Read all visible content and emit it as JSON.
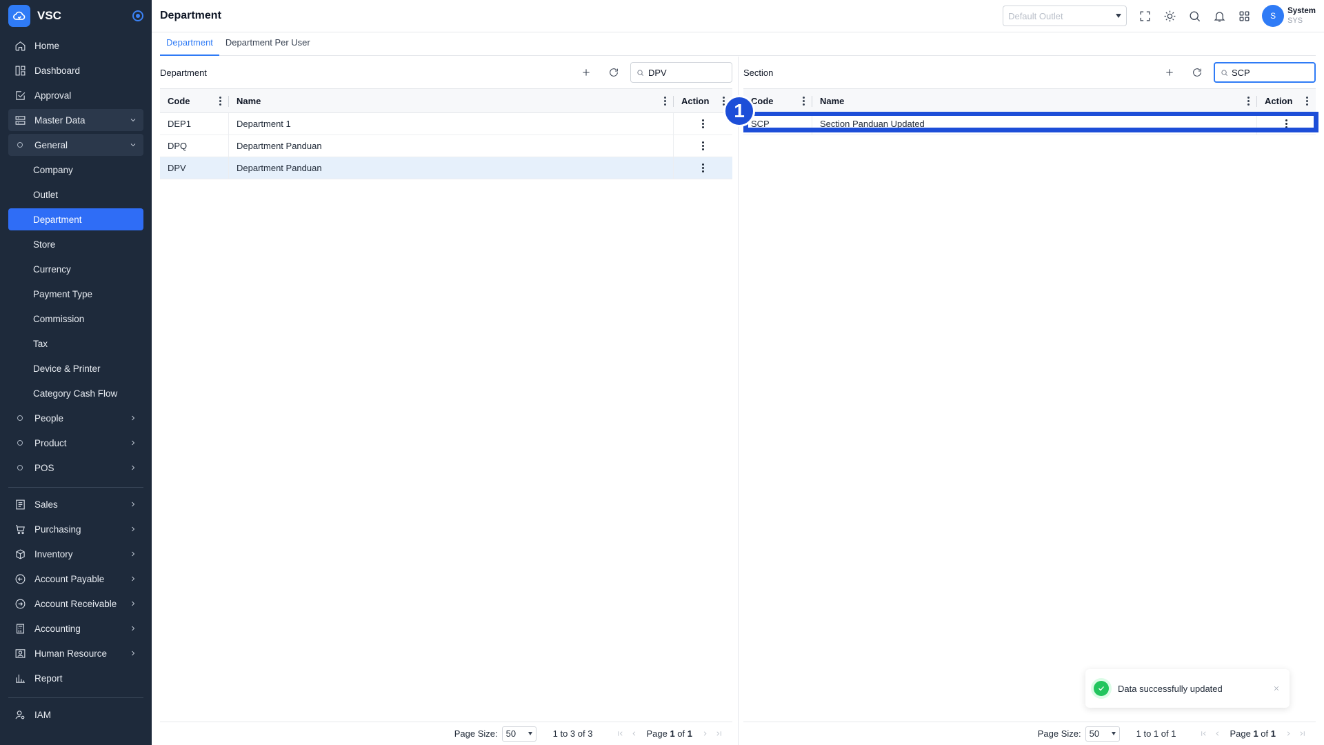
{
  "app": {
    "name": "VSC"
  },
  "header": {
    "title": "Department",
    "outlet_placeholder": "Default Outlet",
    "user": {
      "initial": "S",
      "name": "System",
      "code": "SYS"
    }
  },
  "sidebar": {
    "top": [
      {
        "label": "Home",
        "icon": "home-icon"
      },
      {
        "label": "Dashboard",
        "icon": "dashboard-icon"
      },
      {
        "label": "Approval",
        "icon": "approval-icon"
      },
      {
        "label": "Master Data",
        "icon": "master-data-icon"
      }
    ],
    "general_label": "General",
    "general_items": [
      "Company",
      "Outlet",
      "Department",
      "Store",
      "Currency",
      "Payment Type",
      "Commission",
      "Tax",
      "Device & Printer",
      "Category Cash Flow"
    ],
    "master_groups": [
      "People",
      "Product",
      "POS"
    ],
    "modules": [
      {
        "label": "Sales",
        "icon": "sales-icon"
      },
      {
        "label": "Purchasing",
        "icon": "cart-icon"
      },
      {
        "label": "Inventory",
        "icon": "box-icon"
      },
      {
        "label": "Account Payable",
        "icon": "arrow-left-circle-icon"
      },
      {
        "label": "Account Receivable",
        "icon": "arrow-right-circle-icon"
      },
      {
        "label": "Accounting",
        "icon": "calculator-icon"
      },
      {
        "label": "Human Resource",
        "icon": "person-card-icon"
      },
      {
        "label": "Report",
        "icon": "report-icon"
      }
    ],
    "iam_label": "IAM"
  },
  "tabs": [
    "Department",
    "Department Per User"
  ],
  "department_panel": {
    "title": "Department",
    "search_value": "DPV",
    "columns": [
      "Code",
      "Name",
      "Action"
    ],
    "rows": [
      {
        "code": "DEP1",
        "name": "Department 1"
      },
      {
        "code": "DPQ",
        "name": "Department Panduan"
      },
      {
        "code": "DPV",
        "name": "Department Panduan"
      }
    ],
    "footer": {
      "page_size_label": "Page Size:",
      "page_size": "50",
      "range": "1 to 3 of 3",
      "page_word": "Page",
      "page": "1",
      "of_word": "of",
      "pages": "1"
    }
  },
  "section_panel": {
    "title": "Section",
    "search_value": "SCP",
    "columns": [
      "Code",
      "Name",
      "Action"
    ],
    "rows": [
      {
        "code": "SCP",
        "name": "Section Panduan Updated"
      }
    ],
    "footer": {
      "page_size_label": "Page Size:",
      "page_size": "50",
      "range": "1 to 1 of 1",
      "page_word": "Page",
      "page": "1",
      "of_word": "of",
      "pages": "1"
    }
  },
  "annotation": {
    "step": "1"
  },
  "toast": {
    "message": "Data successfully updated"
  },
  "colors": {
    "sidebar_bg": "#1e2a3b",
    "accent": "#2f6df6",
    "highlight": "#1d4ed8",
    "success": "#22c55e"
  }
}
